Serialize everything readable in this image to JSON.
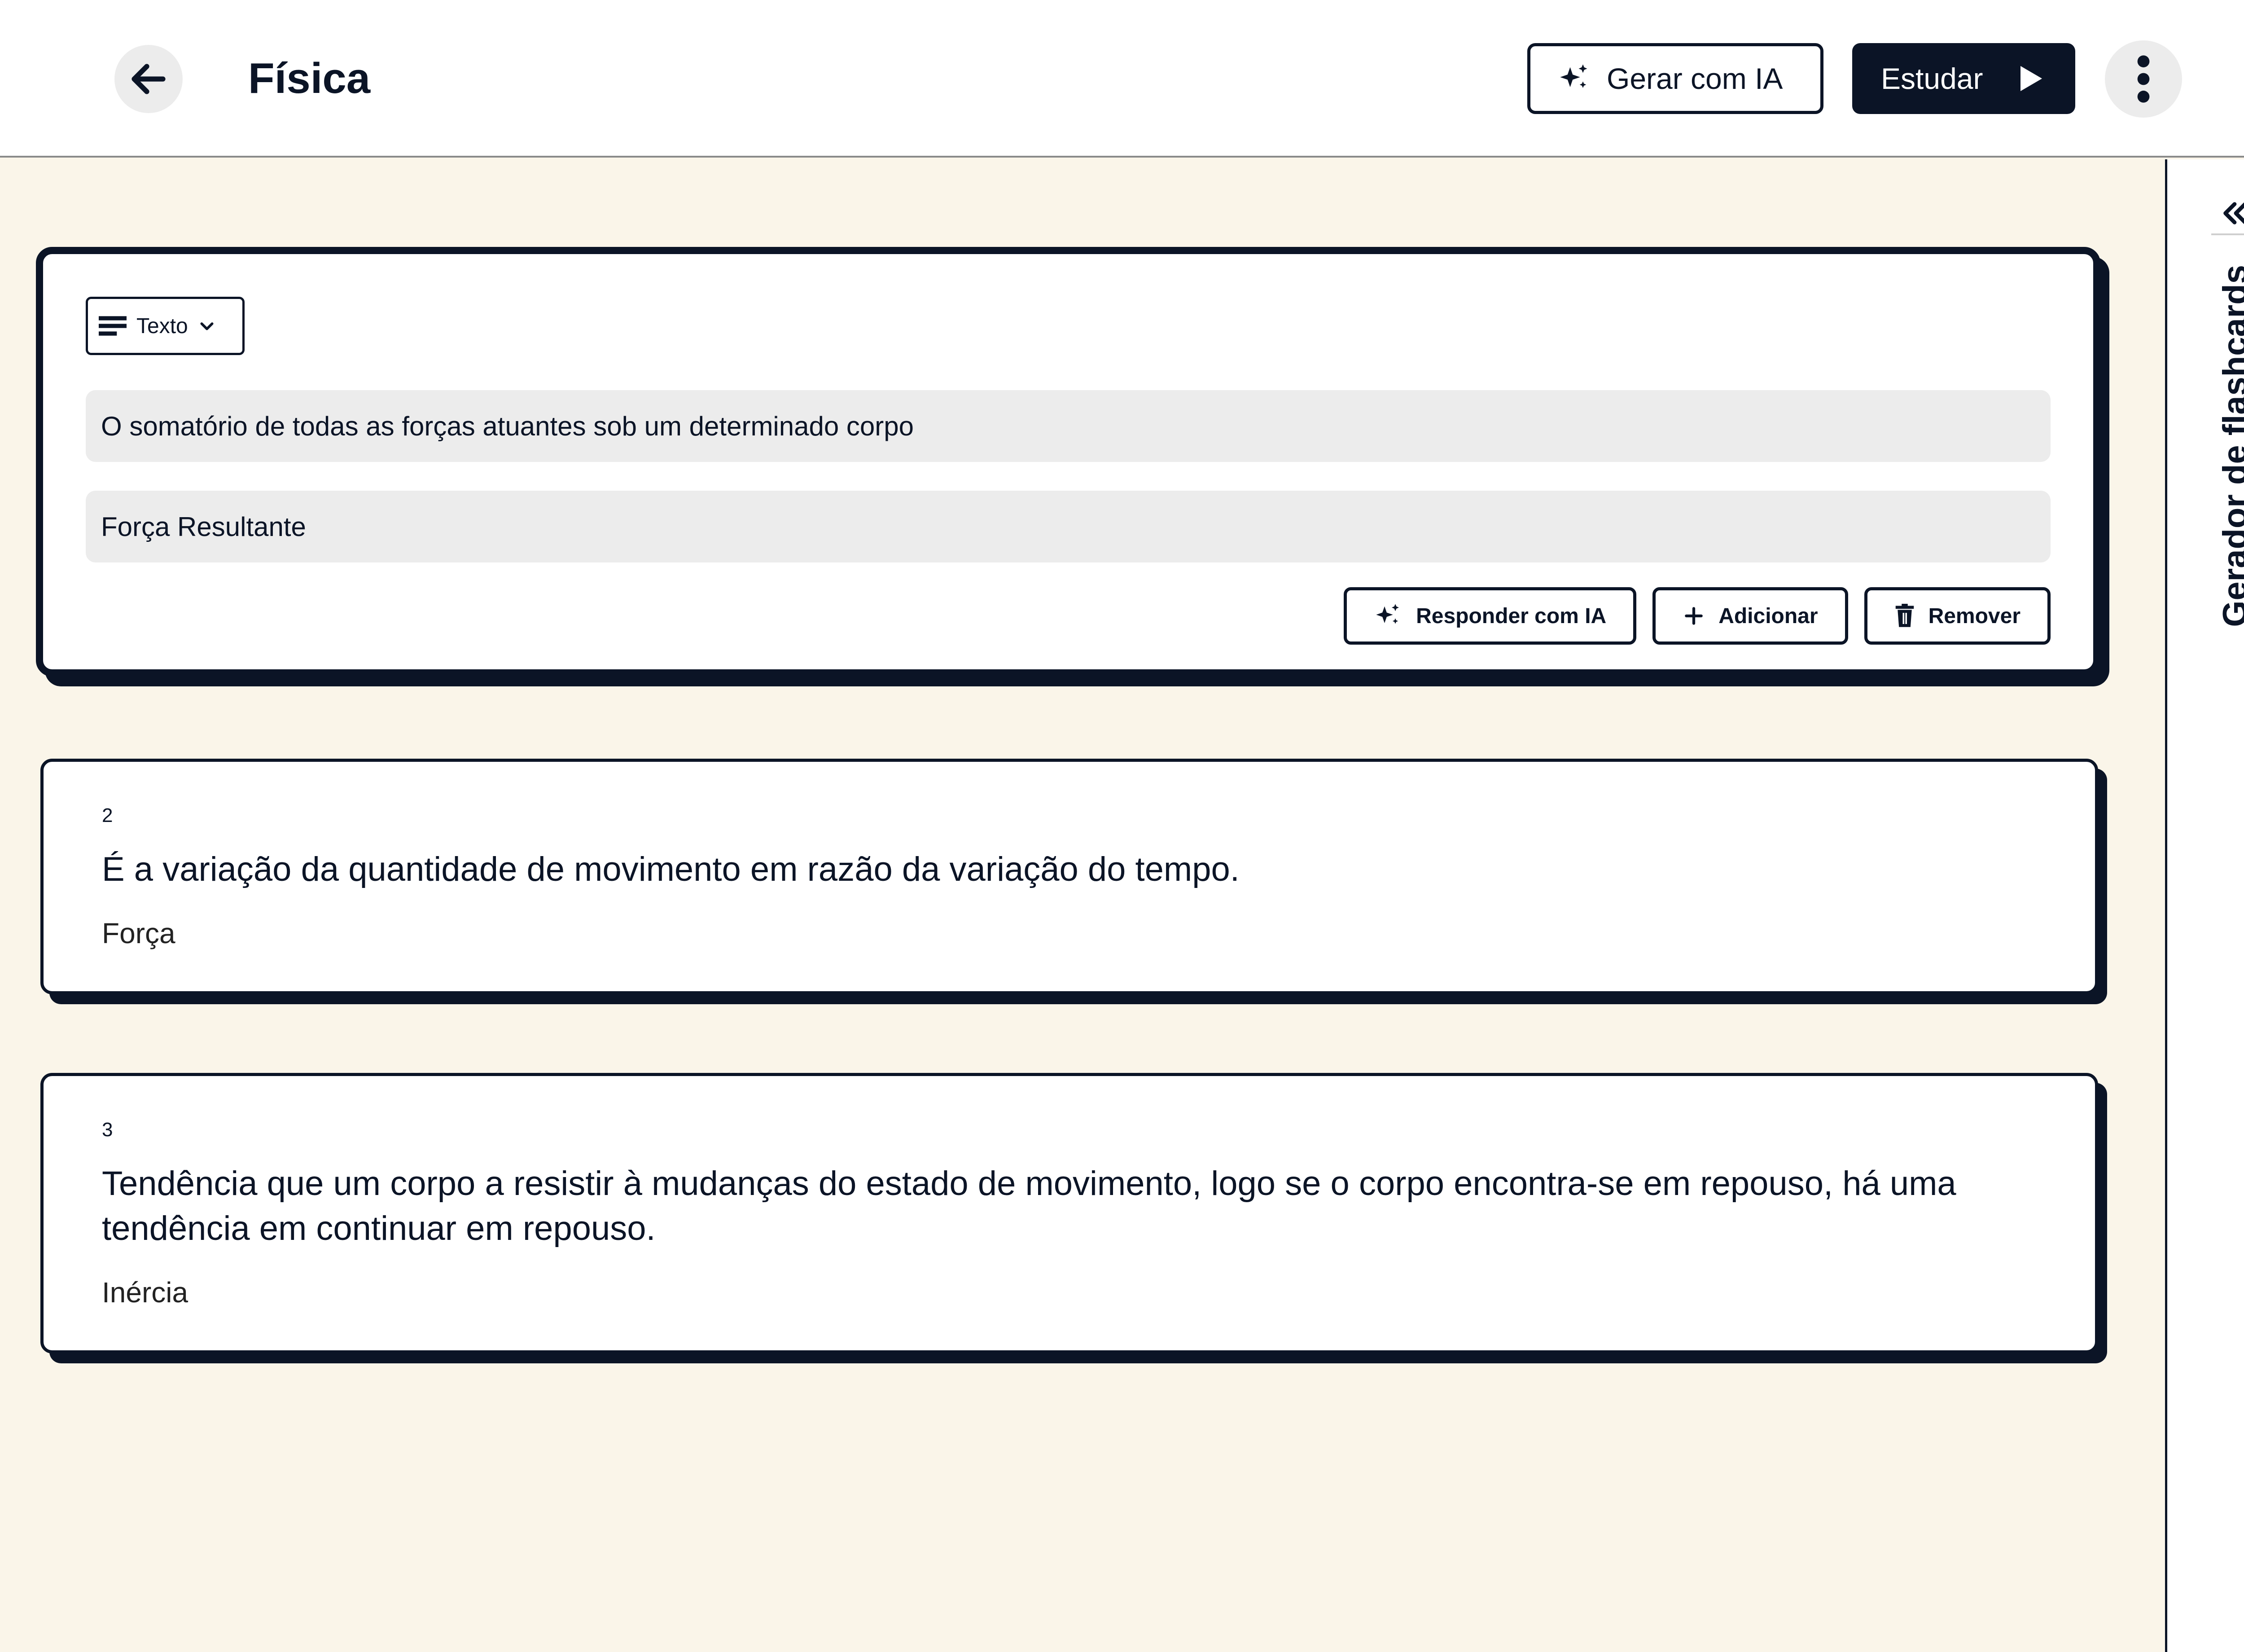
{
  "header": {
    "title": "Física",
    "generate_label": "Gerar com IA",
    "study_label": "Estudar"
  },
  "side_panel": {
    "title": "Gerador de flashcards"
  },
  "editing_card": {
    "type_select": "Texto",
    "front_value": "O somatório de todas as forças atuantes sob um determinado corpo",
    "back_value": "Força Resultante",
    "actions": {
      "answer_ai": "Responder com IA",
      "add": "Adicionar",
      "remove": "Remover"
    }
  },
  "cards": [
    {
      "number": "2",
      "front": "É a variação da quantidade de movimento em razão da variação do tempo.",
      "back": "Força"
    },
    {
      "number": "3",
      "front": "Tendência que um corpo a resistir à mudanças do estado de movimento, logo se o corpo encontra-se em repouso, há uma tendência em continuar em repouso.",
      "back": "Inércia"
    }
  ],
  "icons": {
    "back": "arrow-left-icon",
    "sparkle": "sparkle-icon",
    "play": "play-icon",
    "more": "more-vertical-icon",
    "collapse": "chevron-double-left-icon",
    "text_type": "text-lines-icon",
    "dropdown": "chevron-down-icon",
    "add": "plus-icon",
    "remove": "trash-icon"
  },
  "colors": {
    "background": "#faf5e9",
    "primary": "#0b1426",
    "field": "#ececec"
  }
}
